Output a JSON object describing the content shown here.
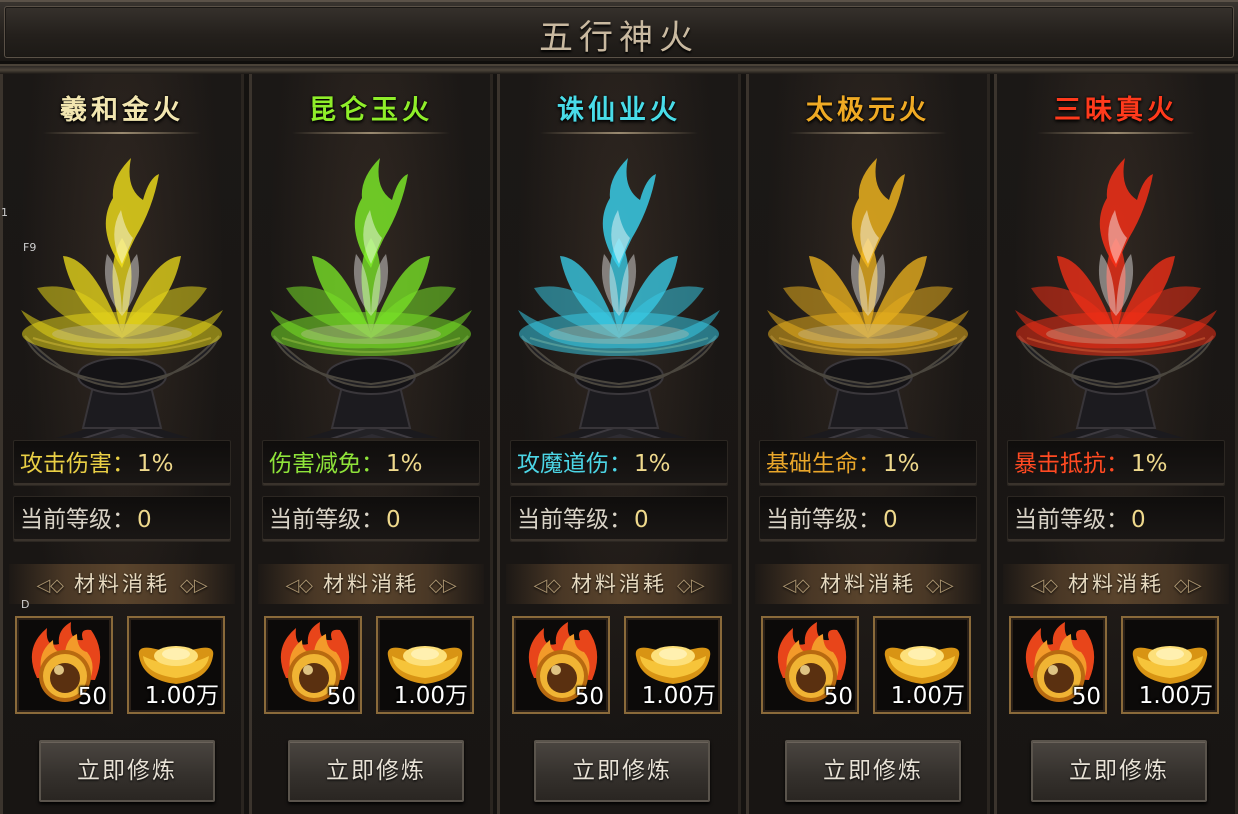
{
  "title": "五行神火",
  "overlay_labels": [
    "1",
    "F9",
    "D"
  ],
  "material_header": "材料消耗",
  "level_label": "当前等级：",
  "cultivate_button": "立即修炼",
  "fires": [
    {
      "name": "羲和金火",
      "name_color": "#f2e6b0",
      "flame_color": "#f2e11a",
      "stat_label": "攻击伤害：",
      "stat_label_color": "#e9cf45",
      "stat_value": "1%",
      "level": "0",
      "materials": [
        {
          "icon": "fire-orb-icon",
          "qty": "50"
        },
        {
          "icon": "gold-ingot-icon",
          "qty": "1.00万"
        }
      ]
    },
    {
      "name": "昆仑玉火",
      "name_color": "#8fee2a",
      "flame_color": "#7ef028",
      "stat_label": "伤害减免：",
      "stat_label_color": "#8fe43a",
      "stat_value": "1%",
      "level": "0",
      "materials": [
        {
          "icon": "fire-orb-icon",
          "qty": "50"
        },
        {
          "icon": "gold-ingot-icon",
          "qty": "1.00万"
        }
      ]
    },
    {
      "name": "诛仙业火",
      "name_color": "#49dce8",
      "flame_color": "#39d6f2",
      "stat_label": "攻魔道伤：",
      "stat_label_color": "#4cd6e6",
      "stat_value": "1%",
      "level": "0",
      "materials": [
        {
          "icon": "fire-orb-icon",
          "qty": "50"
        },
        {
          "icon": "gold-ingot-icon",
          "qty": "1.00万"
        }
      ]
    },
    {
      "name": "太极元火",
      "name_color": "#efaa24",
      "flame_color": "#f5b91e",
      "stat_label": "基础生命：",
      "stat_label_color": "#e9a62a",
      "stat_value": "1%",
      "level": "0",
      "materials": [
        {
          "icon": "fire-orb-icon",
          "qty": "50"
        },
        {
          "icon": "gold-ingot-icon",
          "qty": "1.00万"
        }
      ]
    },
    {
      "name": "三昧真火",
      "name_color": "#ff3a1c",
      "flame_color": "#ff3016",
      "stat_label": "暴击抵抗：",
      "stat_label_color": "#ff4a22",
      "stat_value": "1%",
      "level": "0",
      "materials": [
        {
          "icon": "fire-orb-icon",
          "qty": "50"
        },
        {
          "icon": "gold-ingot-icon",
          "qty": "1.00万"
        }
      ]
    }
  ]
}
